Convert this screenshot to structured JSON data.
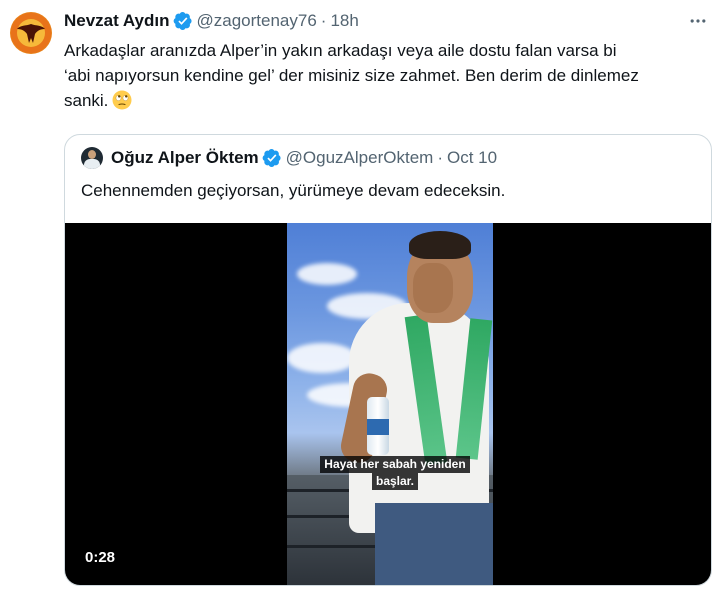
{
  "tweet": {
    "author_name": "Nevzat Aydın",
    "handle": "@zagortenay76",
    "separator": "·",
    "time": "18h",
    "text_lines": [
      "Arkadaşlar aranızda Alper’in yakın arkadaşı veya aile dostu falan varsa bi",
      "‘abi napıyorsun kendine gel’ der misiniz size zahmet. Ben derim de dinlemez",
      "sanki."
    ],
    "emoji": "rolling-eyes-emoji",
    "icons": {
      "avatar": "avatar-icon",
      "verified": "verified-badge-icon",
      "more": "more-options-icon"
    }
  },
  "quote": {
    "author_name": "Oğuz Alper Öktem",
    "handle": "@OguzAlperOktem",
    "separator": "·",
    "time": "Oct 10",
    "text": "Cehennemden geçiyorsan, yürümeye devam edeceksin.",
    "video": {
      "subtitle_line1": "Hayat her sabah yeniden",
      "subtitle_line2": "başlar.",
      "duration": "0:28"
    }
  },
  "colors": {
    "text_primary": "#0f1419",
    "text_secondary": "#536471",
    "verified_blue": "#1d9bf0",
    "border": "#cfd9de"
  }
}
